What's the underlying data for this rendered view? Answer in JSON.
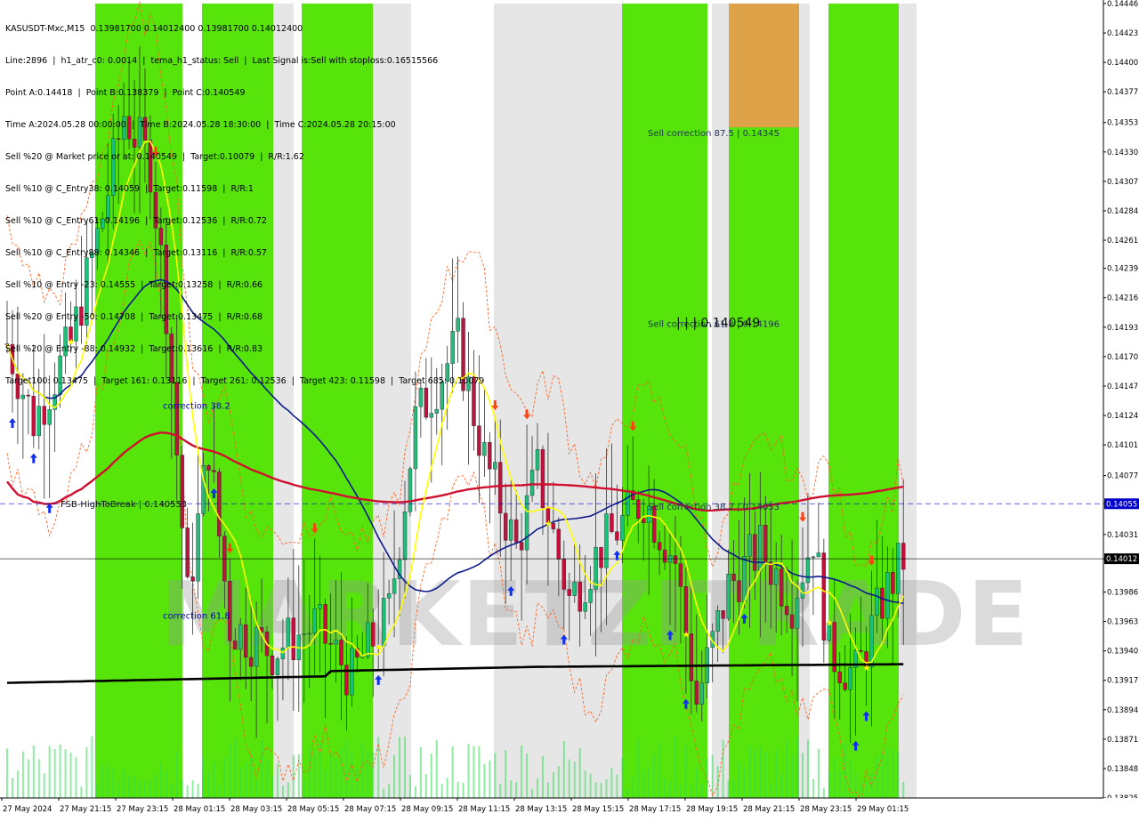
{
  "chart_data": {
    "type": "candlestick",
    "symbol_line": "KASUSDT-Mxc,M15  0.13981700 0.14012400 0.13981700 0.14012400",
    "info_lines": [
      "Line:2896  |  h1_atr_c0: 0.0014  |  tema_h1_status: Sell  |  Last Signal is:Sell with stoploss:0.16515566",
      "Point A:0.14418  |  Point B:0.138379  |  Point C:0.140549",
      "Time A:2024.05.28 00:00:00  |  Time B:2024.05.28 18:30:00  |  Time C:2024.05.28 20:15:00",
      "Sell %20 @ Market price or at: 0.140549  |  Target:0.10079  |  R/R:1.62",
      "Sell %10 @ C_Entry38: 0.14059  |  Target:0.11598  |  R/R:1",
      "Sell %10 @ C_Entry61: 0.14196  |  Target:0.12536  |  R/R:0.72",
      "Sell %10 @ C_Entry88: 0.14346  |  Target:0.13116  |  R/R:0.57",
      "Sell %10 @ Entry -23: 0.14555  |  Target:0.13258  |  R/R:0.66",
      "Sell %20 @ Entry -50: 0.14708  |  Target:0.13475  |  R/R:0.68",
      "Sell %20 @ Entry -88: 0.14932  |  Target:0.13616  |  R/R:0.83",
      "Target100: 0.13475  |  Target 161: 0.13116  |  Target 261: 0.12536  |  Target 423: 0.11598  |  Target 685: 0.10079"
    ],
    "y_ticks": [
      "0.14446",
      "0.14423",
      "0.14400",
      "0.14377",
      "0.14353",
      "0.14330",
      "0.14307",
      "0.14284",
      "0.14261",
      "0.14239",
      "0.14216",
      "0.14193",
      "0.14170",
      "0.14147",
      "0.14124",
      "0.14101",
      "0.14077",
      "0.14055",
      "0.14031",
      "0.14012",
      "0.13986",
      "0.13963",
      "0.13940",
      "0.13917",
      "0.13894",
      "0.13871",
      "0.13848",
      "0.13825"
    ],
    "ylim": [
      0.13825,
      0.14446
    ],
    "x_labels": [
      "27 May 2024",
      "27 May 21:15",
      "27 May 23:15",
      "28 May 01:15",
      "28 May 03:15",
      "28 May 05:15",
      "28 May 07:15",
      "28 May 09:15",
      "28 May 11:15",
      "28 May 13:15",
      "28 May 15:15",
      "28 May 17:15",
      "28 May 19:15",
      "28 May 21:15",
      "28 May 23:15",
      "29 May 01:15"
    ],
    "price_labels": [
      {
        "text": "0.14055",
        "value": 0.14055,
        "color": "#0000cc"
      },
      {
        "text": "0.14012",
        "value": 0.14012,
        "color": "#000000"
      }
    ],
    "annotations": [
      {
        "text": "Sell correction 87.5 | 0.14345",
        "value": 0.14345,
        "color": "#22335a"
      },
      {
        "text": "Sell correction 61.8 | 0.14196",
        "value": 0.14196,
        "color": "#22335a"
      },
      {
        "text": "| | | 0.140549",
        "value": 0.14196,
        "color": "#111111"
      },
      {
        "text": "Sell correction 38.2 | 0.14053",
        "value": 0.14053,
        "color": "#22335a"
      },
      {
        "text": "FSB-HighToBreak  |  0.140553",
        "value": 0.140553,
        "color": "#111111"
      },
      {
        "text": "correction 38.2",
        "value": 0.14132,
        "color": "#0000cc"
      },
      {
        "text": "correction 61.8",
        "value": 0.13968,
        "color": "#0000cc"
      }
    ],
    "watermark": "MARKETZITRADE",
    "colors": {
      "bull": "#1fbf7a",
      "bear": "#c4103c",
      "zone_green": "#56e40a",
      "zone_orange": "#dea348",
      "gray_band": "#d2d2d2",
      "sma_blue": "#0d1a8c",
      "sma_red": "#d01030",
      "sma_black": "#000000",
      "yellow": "#ffff00"
    }
  }
}
